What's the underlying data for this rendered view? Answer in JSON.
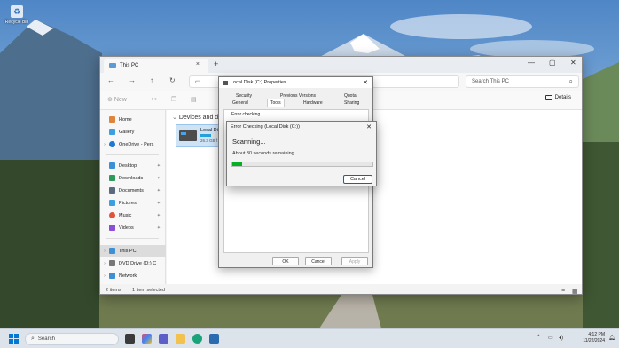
{
  "desktop": {
    "recycle_bin_label": "Recycle Bin"
  },
  "explorer": {
    "tab_title": "This PC",
    "search_placeholder": "Search This PC",
    "new_label": "New",
    "details_label": "Details",
    "sidebar": [
      {
        "label": "Home",
        "icon": "home-icon",
        "color": "#e0843b"
      },
      {
        "label": "Gallery",
        "icon": "gallery-icon",
        "color": "#3aa0e0"
      },
      {
        "label": "OneDrive - Pers",
        "icon": "cloud-icon",
        "color": "#1f78d1"
      },
      {
        "label": "Desktop",
        "icon": "desktop-icon",
        "color": "#3d8fd6"
      },
      {
        "label": "Downloads",
        "icon": "download-icon",
        "color": "#2f9a5a"
      },
      {
        "label": "Documents",
        "icon": "document-icon",
        "color": "#5a6b7d"
      },
      {
        "label": "Pictures",
        "icon": "pictures-icon",
        "color": "#3aa0e0"
      },
      {
        "label": "Music",
        "icon": "music-icon",
        "color": "#e0543b"
      },
      {
        "label": "Videos",
        "icon": "video-icon",
        "color": "#8a4fd6"
      },
      {
        "label": "This PC",
        "icon": "pc-icon",
        "color": "#3d8fd6"
      },
      {
        "label": "DVD Drive (D:) C",
        "icon": "dvd-icon",
        "color": "#777777"
      },
      {
        "label": "Network",
        "icon": "network-icon",
        "color": "#3d8fd6"
      }
    ],
    "group_label": "Devices and d",
    "drive": {
      "name": "Local Disk",
      "free_text": "26.3 GB f",
      "used_fraction": 0.55
    },
    "status_items": "2 items",
    "status_selected": "1 item selected"
  },
  "properties": {
    "title": "Local Disk (C:) Properties",
    "tabs_row1": [
      "Security",
      "Previous Versions",
      "Quota"
    ],
    "tabs_row2": [
      "General",
      "Tools",
      "Hardware",
      "Sharing"
    ],
    "section": "Error checking",
    "ok": "OK",
    "cancel": "Cancel",
    "apply": "Apply"
  },
  "error_check": {
    "title": "Error Checking (Local Disk (C:))",
    "status": "Scanning...",
    "remaining": "About 30 seconds remaining",
    "progress_fraction": 0.07,
    "cancel": "Cancel"
  },
  "taskbar": {
    "search_label": "Search",
    "time": "4:12 PM",
    "date": "11/22/2024"
  },
  "colors": {
    "accent": "#0078d4",
    "progress_green": "#06b025"
  }
}
